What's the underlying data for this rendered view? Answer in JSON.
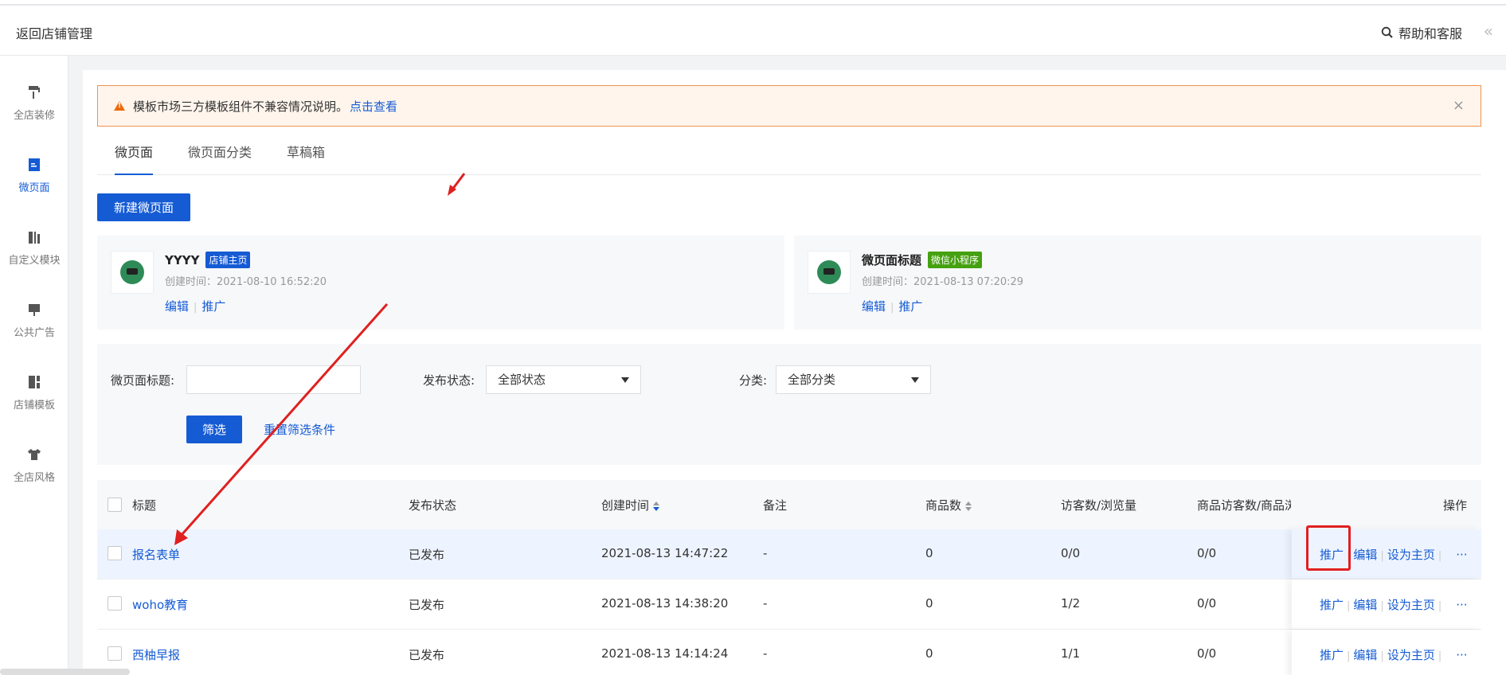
{
  "header": {
    "back_label": "返回店铺管理",
    "help_label": "帮助和客服",
    "collapse_glyph": "«"
  },
  "sidebar": {
    "items": [
      {
        "label": "全店装修",
        "icon": "paint-roller-icon"
      },
      {
        "label": "微页面",
        "icon": "page-icon",
        "active": true
      },
      {
        "label": "自定义模块",
        "icon": "module-icon"
      },
      {
        "label": "公共广告",
        "icon": "ad-board-icon"
      },
      {
        "label": "店铺模板",
        "icon": "template-icon"
      },
      {
        "label": "全店风格",
        "icon": "shirt-icon"
      }
    ]
  },
  "notice": {
    "text": "模板市场三方模板组件不兼容情况说明。",
    "link": "点击查看",
    "close_glyph": "×"
  },
  "tabs": [
    "微页面",
    "微页面分类",
    "草稿箱"
  ],
  "new_button": "新建微页面",
  "cards": [
    {
      "title": "YYYY",
      "badge": "店铺主页",
      "created": "创建时间：2021-08-10 16:52:20",
      "edit": "编辑",
      "promote": "推广"
    },
    {
      "title": "微页面标题",
      "badge": "微信小程序",
      "created": "创建时间：2021-08-13 07:20:29",
      "edit": "编辑",
      "promote": "推广"
    }
  ],
  "filter": {
    "title_label": "微页面标题:",
    "title_value": "",
    "status_label": "发布状态:",
    "status_value": "全部状态",
    "category_label": "分类:",
    "category_value": "全部分类",
    "submit": "筛选",
    "reset": "重置筛选条件"
  },
  "table": {
    "headers": [
      "标题",
      "发布状态",
      "创建时间",
      "备注",
      "商品数",
      "访客数/浏览量",
      "商品访客数/商品浏",
      "操作"
    ],
    "rows": [
      {
        "title": "报名表单",
        "status": "已发布",
        "created": "2021-08-13 14:47:22",
        "note": "-",
        "goods": "0",
        "uv_pv": "0/0",
        "goods_uv": "0/0"
      },
      {
        "title": "woho教育",
        "status": "已发布",
        "created": "2021-08-13 14:38:20",
        "note": "-",
        "goods": "0",
        "uv_pv": "1/2",
        "goods_uv": "0/0"
      },
      {
        "title": "西柚早报",
        "status": "已发布",
        "created": "2021-08-13 14:14:24",
        "note": "-",
        "goods": "0",
        "uv_pv": "1/1",
        "goods_uv": "0/0"
      }
    ],
    "ops": {
      "promote": "推广",
      "edit": "编辑",
      "set_home": "设为主页",
      "more": "···"
    }
  },
  "colors": {
    "accent": "#155bd4",
    "annotation": "#e02020",
    "warning_bg": "#fff5ed",
    "warning_border": "#f1924e"
  }
}
